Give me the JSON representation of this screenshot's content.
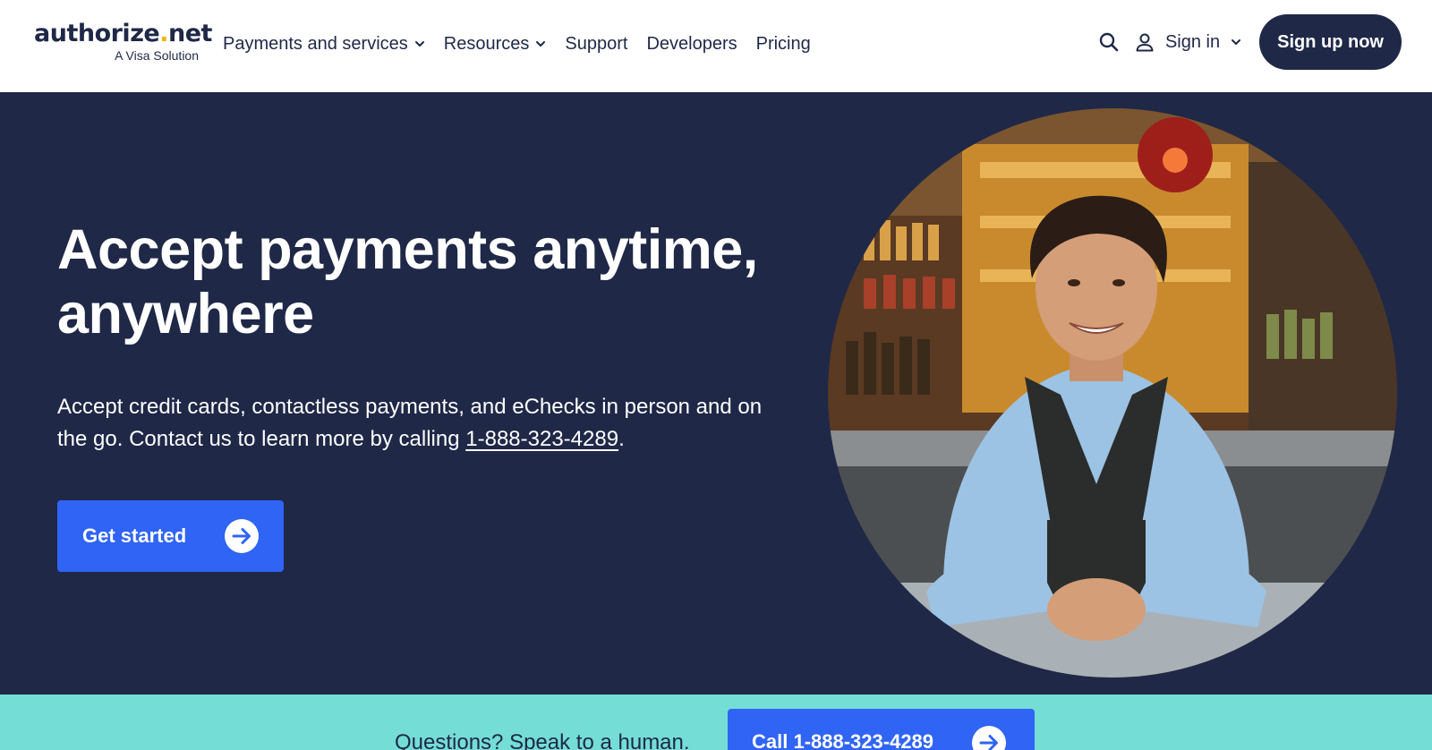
{
  "header": {
    "logo": {
      "name_part1": "authorize",
      "name_dot": ".",
      "name_part2": "net",
      "tagline": "A Visa Solution"
    },
    "nav": [
      {
        "label": "Payments and services",
        "has_dropdown": true
      },
      {
        "label": "Resources",
        "has_dropdown": true
      },
      {
        "label": "Support",
        "has_dropdown": false
      },
      {
        "label": "Developers",
        "has_dropdown": false
      },
      {
        "label": "Pricing",
        "has_dropdown": false
      }
    ],
    "icons": {
      "search": "search-icon",
      "user": "user-icon",
      "signin_dropdown": "chevron-down-icon"
    },
    "signin_label": "Sign in",
    "signup_label": "Sign up now"
  },
  "hero": {
    "title_line1": "Accept payments anytime,",
    "title_line2": "anywhere",
    "text_before_phone": "Accept credit cards, contactless payments, and eChecks in person and on the go. Contact us to learn more by calling ",
    "phone": "1-888-323-4289",
    "text_after_phone": ".",
    "cta_label": "Get started",
    "cta_icon": "arrow-right-circle-icon",
    "image": "photo of smiling woman in apron leaning on bar counter"
  },
  "banner": {
    "text": "Questions? Speak to a human.",
    "button_label": "Call 1-888-323-4289",
    "button_icon": "arrow-right-circle-icon"
  },
  "colors": {
    "navy": "#1f2847",
    "brand_blue": "#2f64f4",
    "teal_banner": "#74ddd6",
    "logo_dot": "#f2b600",
    "white": "#ffffff"
  }
}
